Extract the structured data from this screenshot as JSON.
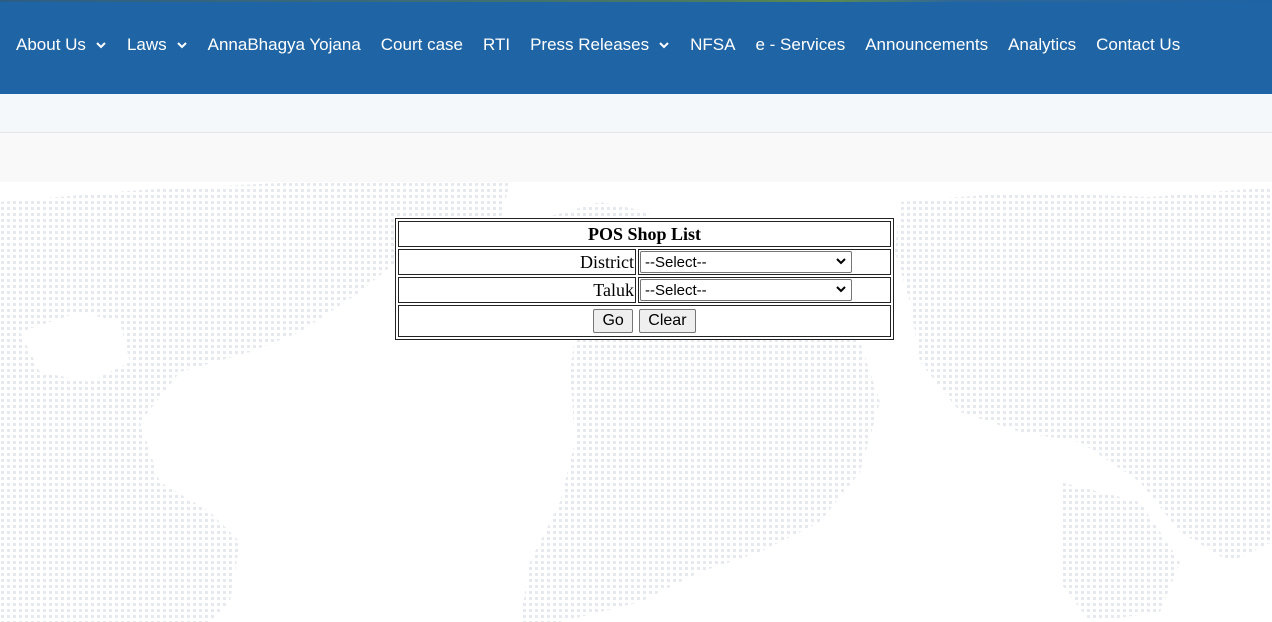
{
  "nav": {
    "items": [
      {
        "label": "About Us",
        "dropdown": true
      },
      {
        "label": "Laws",
        "dropdown": true
      },
      {
        "label": "AnnaBhagya Yojana",
        "dropdown": false
      },
      {
        "label": "Court case",
        "dropdown": false
      },
      {
        "label": "RTI",
        "dropdown": false
      },
      {
        "label": "Press Releases",
        "dropdown": true
      },
      {
        "label": "NFSA",
        "dropdown": false
      },
      {
        "label": "e - Services",
        "dropdown": false
      },
      {
        "label": "Announcements",
        "dropdown": false
      },
      {
        "label": "Analytics",
        "dropdown": false
      },
      {
        "label": "Contact Us",
        "dropdown": false
      }
    ]
  },
  "form": {
    "title": "POS Shop List",
    "district_label": "District",
    "district_value": "--Select--",
    "taluk_label": "Taluk",
    "taluk_value": "--Select--",
    "go_label": "Go",
    "clear_label": "Clear"
  },
  "colors": {
    "navbar": "#1f65a6",
    "nav_text": "#ffffff"
  }
}
